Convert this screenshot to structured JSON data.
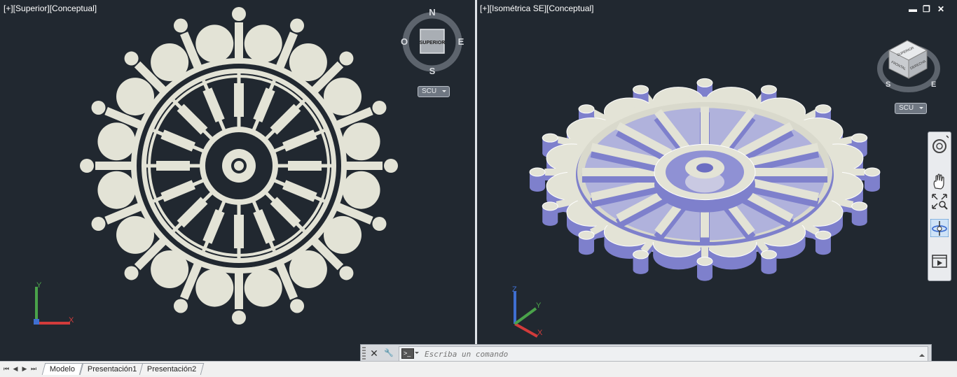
{
  "viewports": {
    "left": {
      "label": "[+][Superior][Conceptual]"
    },
    "right": {
      "label": "[+][Isométrica SE][Conceptual]"
    }
  },
  "viewcube_left": {
    "north": "N",
    "south": "S",
    "east": "E",
    "west": "O",
    "face_label": "SUPERIOR",
    "ucs_label": "SCU"
  },
  "viewcube_right": {
    "faces": [
      "SUPERIOR",
      "FRONTAL",
      "DERECHA"
    ],
    "south": "S",
    "east": "E",
    "ucs_label": "SCU"
  },
  "window_controls": {
    "minimize": "▬",
    "restore": "❐",
    "close": "✕"
  },
  "ucs_icon": {
    "x": "X",
    "y": "Y",
    "z": "Z"
  },
  "navigation_bar": {
    "tools": [
      "steering-wheel",
      "pan",
      "zoom-extents",
      "orbit",
      "showmotion"
    ]
  },
  "command_line": {
    "close_label": "✕",
    "customize_label": "🔧",
    "prompt_label": ">_",
    "placeholder": "Escriba un comando",
    "value": ""
  },
  "layout_tabs": [
    "Modelo",
    "Presentación1",
    "Presentación2"
  ],
  "active_tab": "Modelo",
  "colors": {
    "viewport_bg": "#212830",
    "model_fill": "#e3e3d6",
    "model_shade": "#7e80cc",
    "axis_x": "#d23b3b",
    "axis_y": "#4aa24a",
    "axis_z": "#3f6fd1"
  }
}
